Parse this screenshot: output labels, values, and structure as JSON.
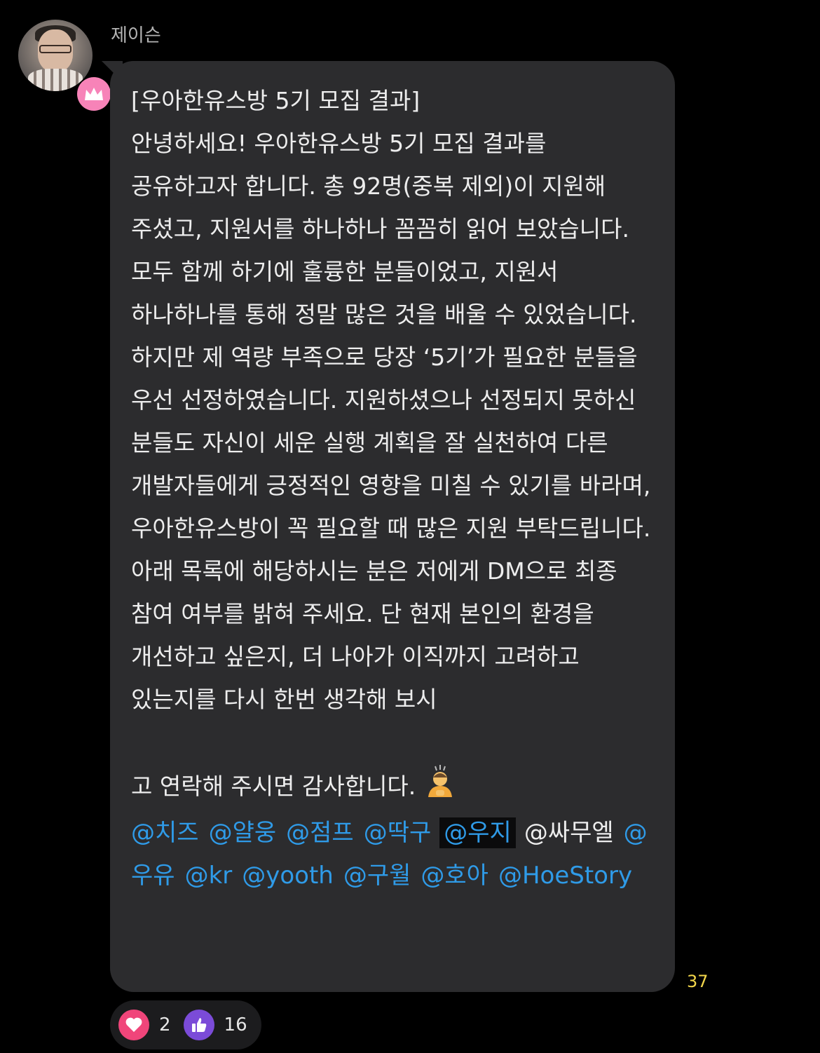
{
  "sender": {
    "name": "제이슨",
    "badge_color": "#f783b8"
  },
  "message": {
    "title": "[우아한유스방 5기 모집 결과]",
    "body": "안녕하세요! 우아한유스방 5기 모집 결과를 공유하고자 합니다. 총 92명(중복 제외)이 지원해 주셨고, 지원서를 하나하나 꼼꼼히 읽어 보았습니다. 모두 함께 하기에 훌륭한 분들이었고, 지원서 하나하나를 통해 정말 많은 것을 배울 수 있었습니다. 하지만 제 역량 부족으로 당장 ‘5기’가 필요한 분들을 우선 선정하였습니다. 지원하셨으나 선정되지 못하신 분들도 자신이 세운 실행 계획을 잘 실천하여 다른 개발자들에게 긍정적인 영향을 미칠 수 있기를 바라며, 우아한유스방이 꼭 필요할 때 많은 지원 부탁드립니다.",
    "body2": "아래 목록에 해당하시는 분은 저에게 DM으로 최종 참여 여부를 밝혀 주세요. 단 현재 본인의 환경을 개선하고 싶은지, 더 나아가 이직까지 고려하고 있는지를 다시 한번 생각해 보시",
    "body3": "고 연락해 주시면 감사합니다.",
    "emoji": "person-bowing-emoji",
    "mentions": [
      "@치즈",
      "@얄웅",
      "@점프",
      "@딱구",
      "@우지",
      "@싸무엘",
      "@우유",
      "@kr",
      "@yooth",
      "@구월",
      "@호아",
      "@HoeStory"
    ],
    "time": "37"
  },
  "reactions": [
    {
      "icon": "heart-icon",
      "count": "2",
      "color": "#f0457a"
    },
    {
      "icon": "thumbs-up-icon",
      "count": "16",
      "color": "#7b4bd8"
    }
  ]
}
